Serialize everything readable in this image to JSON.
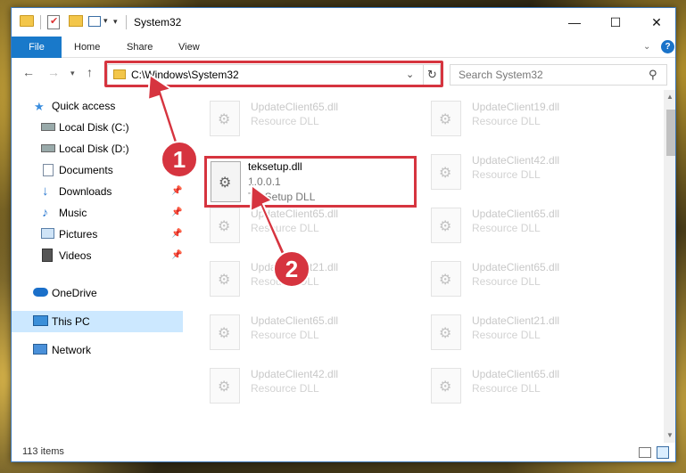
{
  "window": {
    "title": "System32",
    "controls": {
      "minimize": "—",
      "maximize": "☐",
      "close": "✕"
    }
  },
  "ribbon": {
    "file_tab": "File",
    "tabs": [
      "Home",
      "Share",
      "View"
    ],
    "help": "?"
  },
  "address": {
    "path": "C:\\Windows\\System32",
    "search_placeholder": "Search System32"
  },
  "nav_pane": {
    "items": [
      {
        "label": "Quick access",
        "icon": "star-icon"
      },
      {
        "label": "Local Disk (C:)",
        "icon": "drive-icon"
      },
      {
        "label": "Local Disk (D:)",
        "icon": "drive-icon"
      },
      {
        "label": "Documents",
        "icon": "documents-icon",
        "pinned": true
      },
      {
        "label": "Downloads",
        "icon": "download-icon",
        "pinned": true
      },
      {
        "label": "Music",
        "icon": "music-icon",
        "pinned": true
      },
      {
        "label": "Pictures",
        "icon": "pictures-icon",
        "pinned": true
      },
      {
        "label": "Videos",
        "icon": "videos-icon",
        "pinned": true
      },
      {
        "label": "OneDrive",
        "icon": "cloud-icon"
      },
      {
        "label": "This PC",
        "icon": "computer-icon",
        "selected": true
      },
      {
        "label": "Network",
        "icon": "network-icon"
      }
    ]
  },
  "files": [
    {
      "name": "UpdateClient65.dll",
      "type": "Resource DLL"
    },
    {
      "name": "UpdateClient19.dll",
      "type": "Resource DLL"
    },
    {
      "name": "UpdateClient42.dll",
      "type": "Resource DLL"
    },
    {
      "name": "UpdateClient65.dll",
      "type": "Resource DLL"
    },
    {
      "name": "UpdateClient65.dll",
      "type": "Resource DLL"
    },
    {
      "name": "UpdateClient21.dll",
      "type": "Resource DLL"
    },
    {
      "name": "UpdateClient65.dll",
      "type": "Resource DLL"
    },
    {
      "name": "UpdateClient65.dll",
      "type": "Resource DLL"
    },
    {
      "name": "UpdateClient21.dll",
      "type": "Resource DLL"
    },
    {
      "name": "UpdateClient42.dll",
      "type": "Resource DLL"
    },
    {
      "name": "UpdateClient65.dll",
      "type": "Resource DLL"
    }
  ],
  "featured_file": {
    "name": "teksetup.dll",
    "version": "1.0.0.1",
    "description": "TekSetup DLL"
  },
  "status": {
    "item_count": "113 items"
  },
  "annotations": {
    "step1": "1",
    "step2": "2"
  },
  "colors": {
    "accent": "#1979ca",
    "highlight": "#d6343f",
    "selected_bg": "#cce8ff"
  }
}
